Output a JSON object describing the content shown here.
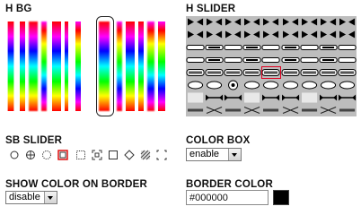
{
  "sections": {
    "h_bg": {
      "title": "H BG"
    },
    "h_slider": {
      "title": "H SLIDER"
    },
    "sb_slider": {
      "title": "SB SLIDER"
    },
    "color_box": {
      "title": "COLOR BOX",
      "value": "enable"
    },
    "show_color_on_border": {
      "title": "SHOW COLOR ON BORDER",
      "value": "disable"
    },
    "border_color": {
      "title": "BORDER COLOR",
      "value": "#000000",
      "swatch_color": "#000000"
    }
  },
  "h_bg_options": [
    {
      "name": "hue-bar-1"
    },
    {
      "name": "hue-bar-2"
    },
    {
      "name": "hue-bar-3"
    },
    {
      "name": "hue-bar-4"
    },
    {
      "name": "hue-bar-5"
    },
    {
      "name": "hue-bar-6"
    },
    {
      "name": "hue-bar-7"
    },
    {
      "name": "hue-bar-8"
    },
    {
      "name": "hue-bar-9"
    },
    {
      "name": "hue-bar-10"
    },
    {
      "name": "hue-bar-11"
    },
    {
      "name": "hue-bar-12"
    },
    {
      "name": "hue-bar-13"
    }
  ],
  "h_bg_selected_index": 7,
  "h_slider_selected": {
    "row": 4,
    "col": 4
  },
  "sb_slider_icons": [
    "circle-icon",
    "crosshair-circle-icon",
    "dotted-circle-icon",
    "red-square-icon",
    "dotted-square-icon",
    "corner-square-icon",
    "square-icon",
    "diamond-icon",
    "hatched-square-icon",
    "bracket-square-icon"
  ],
  "sb_slider_selected_index": 3
}
